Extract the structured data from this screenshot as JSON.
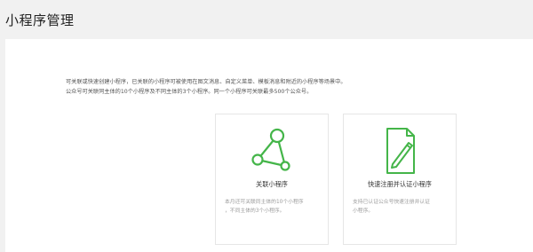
{
  "page": {
    "title": "小程序管理"
  },
  "intro": {
    "lines": [
      "可关联或快速创建小程序，已关联的小程序可被使用在图文消息、自定义菜单、模板消息和附近的小程序等场景中。",
      "公众号可关联同主体的10个小程序及不同主体的3个小程序。同一个小程序可关联最多500个公众号。"
    ]
  },
  "cards": [
    {
      "icon": "link-network-icon",
      "title": "关联小程序",
      "desc_lines": [
        "本月还可关联同主体的10个小程序",
        "，不同主体的3个小程序。"
      ]
    },
    {
      "icon": "register-document-icon",
      "title": "快速注册并认证小程序",
      "desc_lines": [
        "支持已认证公众号快速注册并认证",
        "小程序。"
      ]
    }
  ],
  "colors": {
    "accent": "#44b549",
    "background": "#f1f1f1",
    "panel": "#ffffff"
  }
}
